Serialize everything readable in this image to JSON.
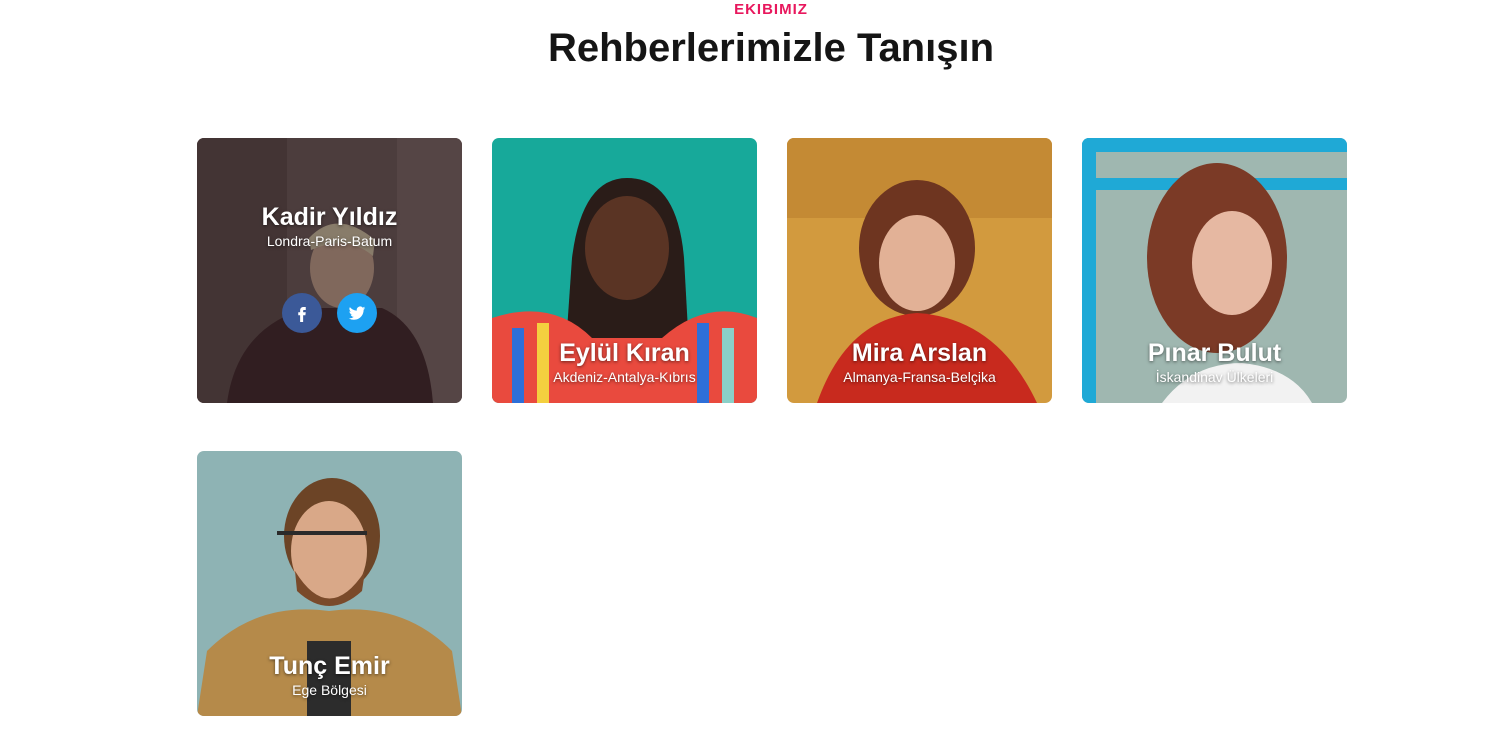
{
  "section": {
    "eyebrow": "EKIBIMIZ",
    "title": "Rehberlerimizle Tanışın"
  },
  "colors": {
    "accent": "#e8175d",
    "facebook": "#3b5998",
    "twitter": "#1da1f2"
  },
  "guides": [
    {
      "name": "Kadir Yıldız",
      "route": "Londra-Paris-Batum",
      "hovered": true,
      "socials": [
        "facebook-icon",
        "twitter-icon"
      ]
    },
    {
      "name": "Eylül Kıran",
      "route": "Akdeniz-Antalya-Kıbrıs"
    },
    {
      "name": "Mira Arslan",
      "route": "Almanya-Fransa-Belçika"
    },
    {
      "name": "Pınar Bulut",
      "route": "İskandinav Ülkeleri"
    },
    {
      "name": "Tunç Emir",
      "route": "Ege Bölgesi"
    }
  ]
}
